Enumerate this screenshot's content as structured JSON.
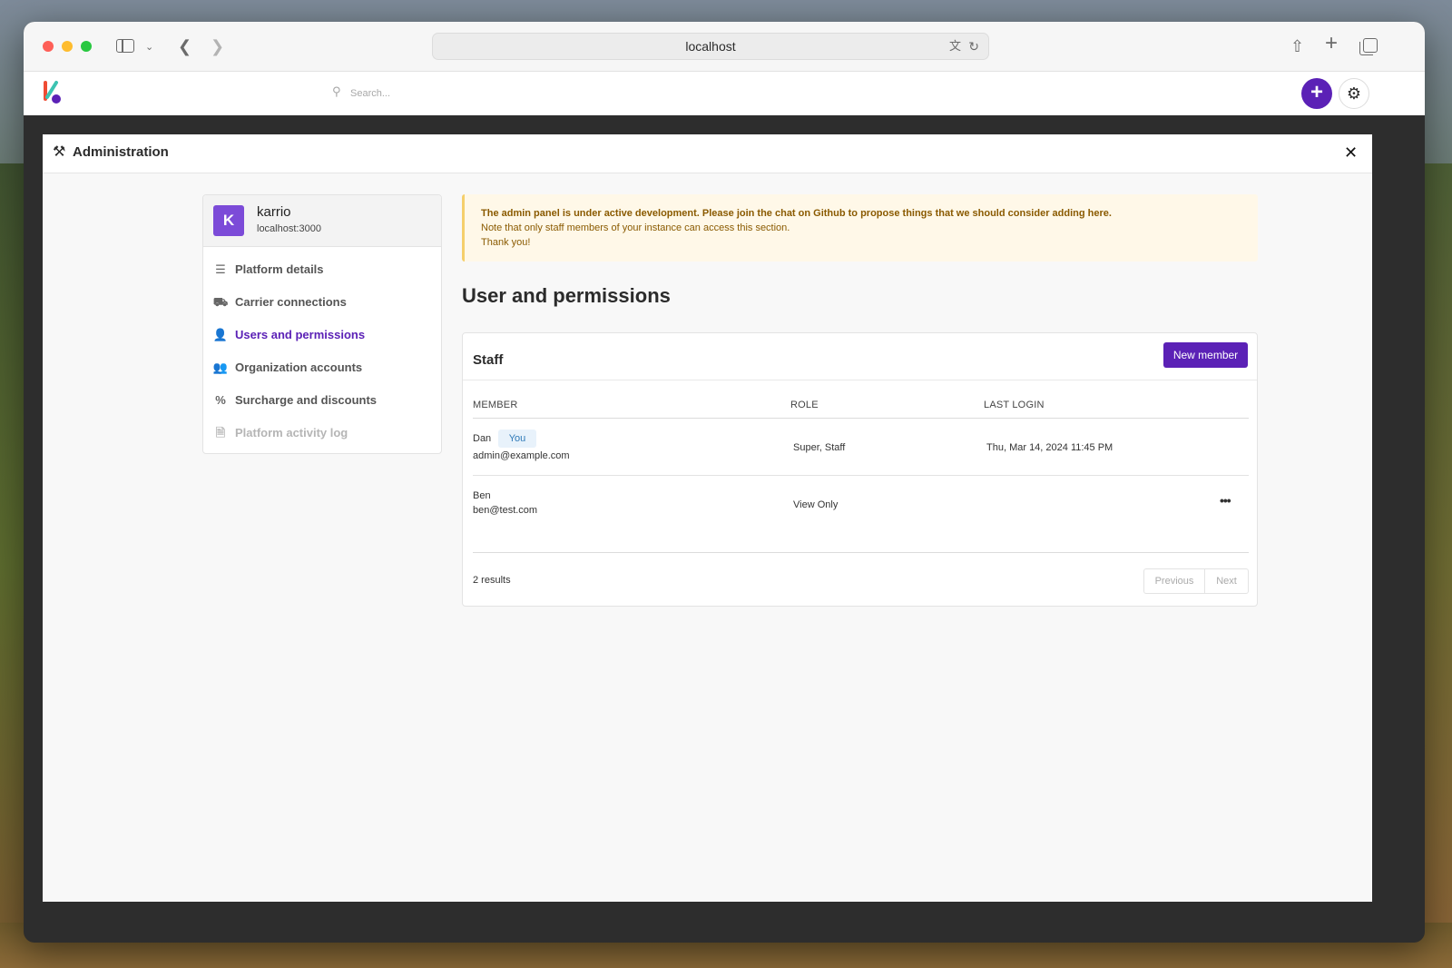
{
  "browser": {
    "url": "localhost",
    "icons": {
      "sidebar": "sidebar-icon",
      "back": "back-icon",
      "forward": "forward-icon",
      "share": "share-icon",
      "new_tab": "plus-icon",
      "tabs": "tabs-icon",
      "translate": "translate-icon",
      "reload": "reload-icon"
    }
  },
  "appbar": {
    "search_placeholder": "Search...",
    "accent_color": "#5b21b6"
  },
  "modal": {
    "title": "Administration"
  },
  "org": {
    "avatar_letter": "K",
    "name": "karrio",
    "host": "localhost:3000"
  },
  "menu": [
    {
      "label": "Platform details",
      "icon": "layers-icon",
      "state": "normal"
    },
    {
      "label": "Carrier connections",
      "icon": "truck-icon",
      "state": "normal"
    },
    {
      "label": "Users and permissions",
      "icon": "user-lock-icon",
      "state": "active"
    },
    {
      "label": "Organization accounts",
      "icon": "users-icon",
      "state": "normal"
    },
    {
      "label": "Surcharge and discounts",
      "icon": "percent-icon",
      "state": "normal"
    },
    {
      "label": "Platform activity log",
      "icon": "file-icon",
      "state": "disabled"
    }
  ],
  "alert": {
    "line1": "The admin panel is under active development. Please join the chat on Github to propose things that we should consider adding here.",
    "line2": "Note that only staff members of your instance can access this section.",
    "line3": "Thank you!"
  },
  "page": {
    "title": "User and permissions"
  },
  "staff": {
    "title": "Staff",
    "new_member_label": "New member",
    "columns": [
      "MEMBER",
      "ROLE",
      "LAST LOGIN"
    ],
    "rows": [
      {
        "name": "Dan",
        "badge": "You",
        "email": "admin@example.com",
        "role": "Super, Staff",
        "last_login": "Thu, Mar 14, 2024 11:45 PM"
      },
      {
        "name": "Ben",
        "badge": "",
        "email": "ben@test.com",
        "role": "View Only",
        "last_login": ""
      }
    ],
    "results_label": "2 results",
    "pager": {
      "prev": "Previous",
      "next": "Next"
    }
  }
}
